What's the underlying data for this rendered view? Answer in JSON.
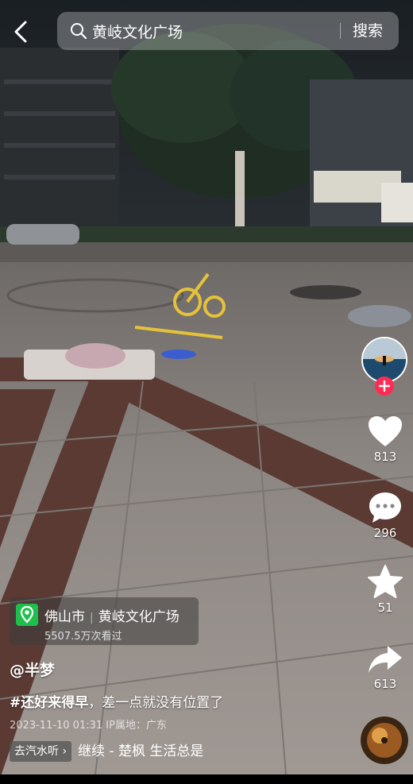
{
  "search": {
    "query": "黄岐文化广场",
    "button_label": "搜索"
  },
  "sidebar": {
    "like_count": "813",
    "comment_count": "296",
    "favorite_count": "51",
    "share_count": "613"
  },
  "location": {
    "city": "佛山市",
    "place": "黄岐文化广场",
    "views": "5507.5万次看过"
  },
  "post": {
    "author": "@半梦",
    "hashtag": "#还好来得早",
    "caption": "，差一点就没有位置了",
    "time_ip": "2023-11-10 01:31 IP属地：广东"
  },
  "music": {
    "chip_label": "去汽水听 ›",
    "title": "继续 - 楚枫   生活总是"
  },
  "colors": {
    "accent_red": "#fe2c55",
    "location_green": "#1fbf4c"
  }
}
